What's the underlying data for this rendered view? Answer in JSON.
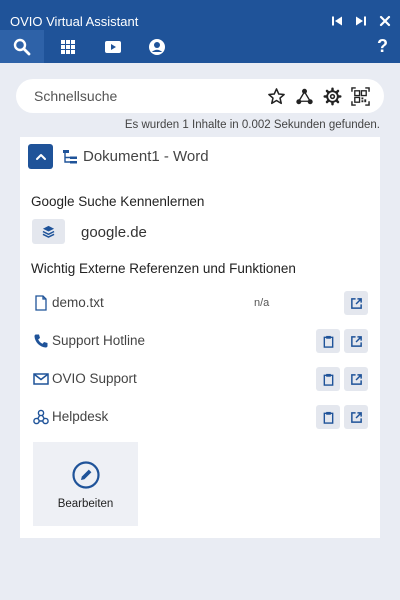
{
  "window": {
    "title": "OVIO Virtual Assistant",
    "controls": [
      "skip-prev-icon",
      "skip-next-icon",
      "close-icon"
    ]
  },
  "nav": {
    "tabs": [
      "search-icon",
      "grid-apps-icon",
      "video-camera-icon",
      "user-account-icon"
    ],
    "active_tab": "search-icon",
    "help_label": "?"
  },
  "search": {
    "placeholder": "Schnellsuche",
    "value": "",
    "icons": [
      "star-icon",
      "network-share-icon",
      "gear-icon",
      "qr-code-icon"
    ]
  },
  "result_info": "Es wurden 1 Inhalte in 0.002 Sekunden gefunden.",
  "document": {
    "title": "Dokument1 - Word",
    "sections": {
      "google": {
        "title": "Google Suche Kennenlernen",
        "link_label": "google.de"
      },
      "refs": {
        "title": "Wichtig Externe Referenzen und Funktionen",
        "items": [
          {
            "icon": "file-icon",
            "label": "demo.txt",
            "meta": "n/a",
            "actions": [
              "open-external-icon"
            ]
          },
          {
            "icon": "phone-icon",
            "label": "Support Hotline",
            "meta": "",
            "actions": [
              "clipboard-icon",
              "open-external-icon"
            ]
          },
          {
            "icon": "mail-icon",
            "label": "OVIO Support",
            "meta": "",
            "actions": [
              "clipboard-icon",
              "open-external-icon"
            ]
          },
          {
            "icon": "helpdesk-icon",
            "label": "Helpdesk",
            "meta": "",
            "actions": [
              "clipboard-icon",
              "open-external-icon"
            ]
          }
        ]
      }
    },
    "edit_label": "Bearbeiten"
  },
  "colors": {
    "header_bg": "#1f5399",
    "active_tab_bg": "#2e62a8",
    "page_bg": "#e9ecf3",
    "accent_icon": "#1f5399",
    "button_bg": "#e4e7ee"
  }
}
